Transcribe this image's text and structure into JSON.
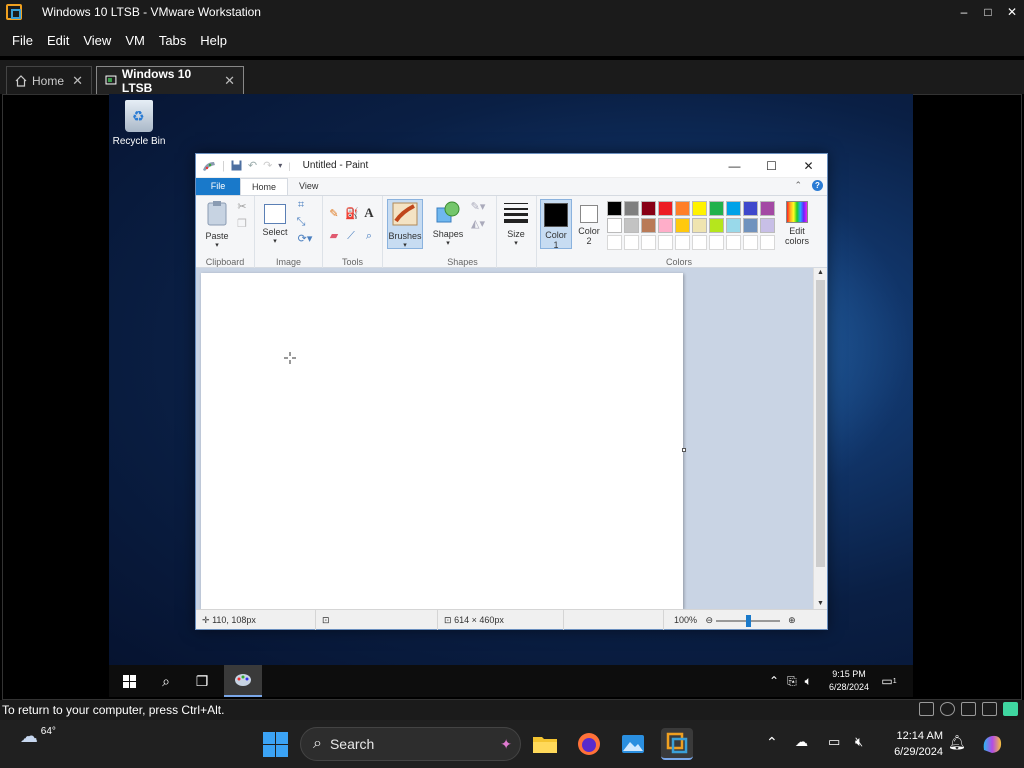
{
  "vmware": {
    "title": "Windows 10 LTSB - VMware Workstation",
    "controls": {
      "minimize": "–",
      "maximize": "□",
      "close": "✕"
    },
    "menu": [
      "File",
      "Edit",
      "View",
      "VM",
      "Tabs",
      "Help"
    ],
    "tabs": [
      {
        "label": "Home",
        "close": "✕"
      },
      {
        "label": "Windows 10 LTSB",
        "close": "✕"
      }
    ],
    "status_text": "To return to your computer, press Ctrl+Alt."
  },
  "desktop": {
    "recycle_bin_label": "Recycle Bin"
  },
  "paint": {
    "title": "Untitled - Paint",
    "window_controls": {
      "minimize": "—",
      "maximize": "☐",
      "close": "✕"
    },
    "tabs": {
      "file": "File",
      "home": "Home",
      "view": "View"
    },
    "help": "?",
    "collapse": "⌃",
    "ribbon": {
      "clipboard": {
        "paste": "Paste",
        "group": "Clipboard"
      },
      "image": {
        "select": "Select",
        "group": "Image"
      },
      "tools": {
        "group": "Tools",
        "text_tool": "A"
      },
      "brushes": "Brushes",
      "shapes": {
        "label": "Shapes",
        "group": "Shapes"
      },
      "size": "Size",
      "color1": {
        "line1": "Color",
        "line2": "1"
      },
      "color2": {
        "line1": "Color",
        "line2": "2"
      },
      "colors_group": "Colors",
      "edit_colors": {
        "line1": "Edit",
        "line2": "colors"
      },
      "palette_row1": [
        "#000000",
        "#7f7f7f",
        "#880015",
        "#ed1c24",
        "#ff7f27",
        "#fff200",
        "#22b14c",
        "#00a2e8",
        "#3f48cc",
        "#a349a4"
      ],
      "palette_row2": [
        "#ffffff",
        "#c3c3c3",
        "#b97a57",
        "#ffaec9",
        "#ffc90e",
        "#efe4b0",
        "#b5e61d",
        "#99d9ea",
        "#7092be",
        "#c8bfe7"
      ],
      "palette_row3": [
        "#ffffff",
        "#ffffff",
        "#ffffff",
        "#ffffff",
        "#ffffff",
        "#ffffff",
        "#ffffff",
        "#ffffff",
        "#ffffff",
        "#ffffff"
      ],
      "color1_value": "#000000",
      "color2_value": "#ffffff"
    },
    "status": {
      "cursor_pos": "110, 108px",
      "canvas_size": "614 × 460px",
      "zoom": "100%",
      "zoom_level": 0.5
    }
  },
  "guest_taskbar": {
    "time": "9:15 PM",
    "date": "6/28/2024",
    "notifications": "1"
  },
  "host_taskbar": {
    "weather_temp": "64°",
    "search_label": "Search",
    "time": "12:14 AM",
    "date": "6/29/2024"
  }
}
